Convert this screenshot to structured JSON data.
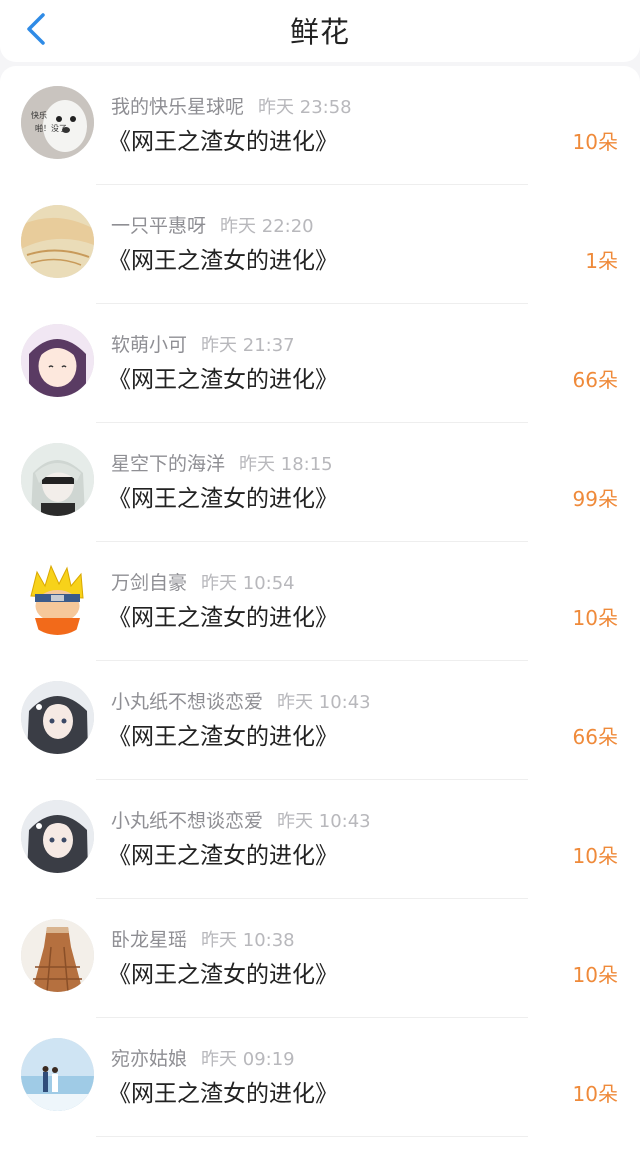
{
  "header": {
    "title": "鲜花"
  },
  "colors": {
    "accent": "#ef8a3a",
    "back": "#2f8be6"
  },
  "items": [
    {
      "name": "我的快乐星球呢",
      "time": "昨天 23:58",
      "book": "《网王之渣女的进化》",
      "count": "10朵",
      "avatar_text_1": "快乐",
      "avatar_text_2": "啪！没了"
    },
    {
      "name": "一只平惠呀",
      "time": "昨天 22:20",
      "book": "《网王之渣女的进化》",
      "count": "1朵"
    },
    {
      "name": "软萌小可",
      "time": "昨天 21:37",
      "book": "《网王之渣女的进化》",
      "count": "66朵"
    },
    {
      "name": "星空下的海洋",
      "time": "昨天 18:15",
      "book": "《网王之渣女的进化》",
      "count": "99朵"
    },
    {
      "name": "万剑自豪",
      "time": "昨天 10:54",
      "book": "《网王之渣女的进化》",
      "count": "10朵"
    },
    {
      "name": "小丸纸不想谈恋爱",
      "time": "昨天 10:43",
      "book": "《网王之渣女的进化》",
      "count": "66朵"
    },
    {
      "name": "小丸纸不想谈恋爱",
      "time": "昨天 10:43",
      "book": "《网王之渣女的进化》",
      "count": "10朵"
    },
    {
      "name": "卧龙星瑶",
      "time": "昨天 10:38",
      "book": "《网王之渣女的进化》",
      "count": "10朵"
    },
    {
      "name": "宛亦姑娘",
      "time": "昨天 09:19",
      "book": "《网王之渣女的进化》",
      "count": "10朵"
    }
  ]
}
